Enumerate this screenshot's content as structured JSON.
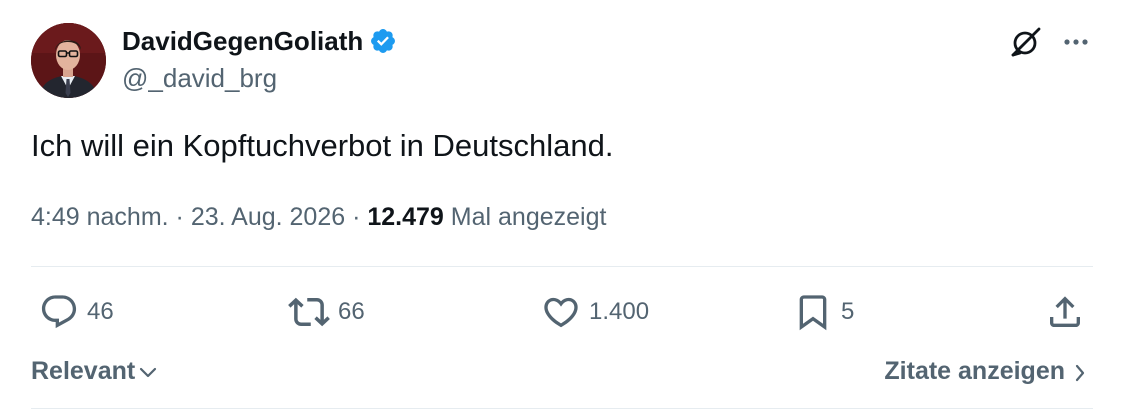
{
  "author": {
    "display_name": "DavidGegenGoliath",
    "handle": "@_david_brg",
    "verified_icon": "verified-badge-icon",
    "verified_color": "#1d9bf0"
  },
  "tweet": {
    "text": "Ich will ein Kopftuchverbot in Deutschland.",
    "time": "4:49 nachm.",
    "separator": "·",
    "date": "23. Aug. 2026",
    "views_count": "12.479",
    "views_label": "Mal angezeigt"
  },
  "header_actions": {
    "grok_icon": "grok-icon",
    "more_icon": "more-dots-icon"
  },
  "stats": {
    "replies": "46",
    "reposts": "66",
    "likes": "1.400",
    "bookmarks": "5"
  },
  "footer": {
    "sort_label": "Relevant",
    "quotes_label": "Zitate anzeigen"
  },
  "colors": {
    "text_primary": "#0f1419",
    "text_secondary": "#536471",
    "divider": "#e6ecf0",
    "accent": "#1d9bf0"
  }
}
